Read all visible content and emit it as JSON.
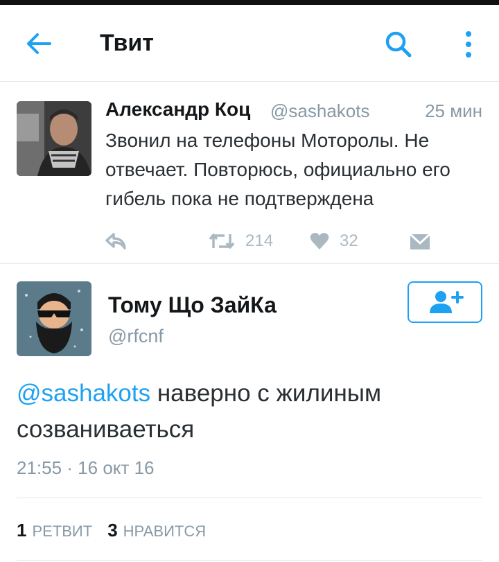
{
  "header": {
    "title": "Твит"
  },
  "original_tweet": {
    "author_name": "Александр Коц",
    "author_handle": "@sashakots",
    "time_ago": "25 мин",
    "text": "Звонил на телефоны Моторолы. Не отвечает. Повторюсь, официально его гибель пока не подтверждена",
    "retweet_count": "214",
    "like_count": "32",
    "icons": [
      "reply-icon",
      "retweet-icon",
      "heart-icon",
      "direct-message-icon"
    ]
  },
  "reply_tweet": {
    "author_name": "Тому Що ЗайКа",
    "author_handle": "@rfcnf",
    "mention": "@sashakots",
    "text": " наверно с жилиным созваниваеться",
    "timestamp": "21:55 · 16 окт 16",
    "retweets_num": "1",
    "retweets_label": "РЕТВИТ",
    "likes_num": "3",
    "likes_label": "НРАВИТСЯ"
  },
  "colors": {
    "accent": "#1da1f2",
    "muted": "#8899a6",
    "icon_gray": "#aab8c2",
    "text": "#292f33"
  }
}
